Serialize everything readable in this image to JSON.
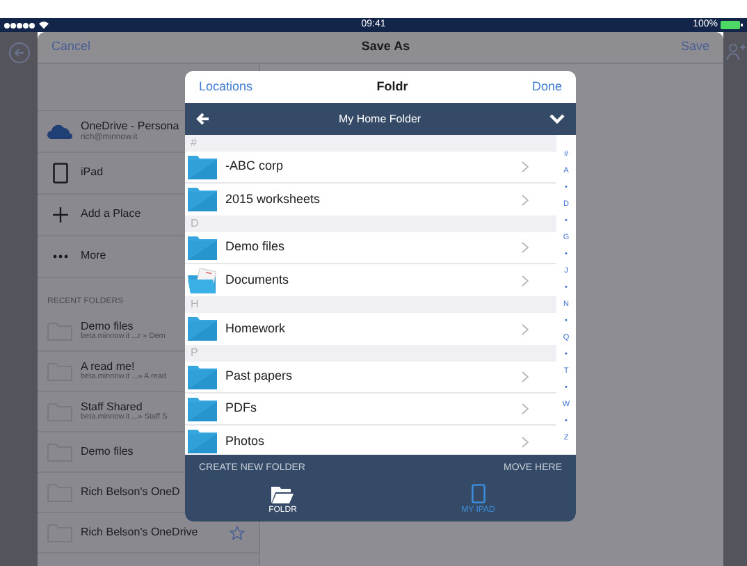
{
  "status_bar": {
    "time": "09:41",
    "battery": "100%"
  },
  "sheet": {
    "cancel": "Cancel",
    "title": "Save As",
    "save": "Save"
  },
  "sidebar": {
    "places": [
      {
        "kind": "onedrive",
        "label": "OneDrive - Persona",
        "sublabel": "rich@minnow.it"
      },
      {
        "kind": "ipad",
        "label": "iPad"
      },
      {
        "kind": "add",
        "label": "Add a Place"
      },
      {
        "kind": "more",
        "label": "More"
      }
    ],
    "recent_header": "RECENT FOLDERS",
    "recent": [
      {
        "name": "Demo files",
        "path": "beta.minnow.it ...r » Dem",
        "pinned": false
      },
      {
        "name": "A read me!",
        "path": "beta.minnow.it ...» A read",
        "pinned": false
      },
      {
        "name": "Staff Shared",
        "path": "beta.minnow.it ...» Staff S",
        "pinned": false
      },
      {
        "name": "Demo files",
        "pinned": false
      },
      {
        "name": "Rich Belson's OneD",
        "pinned": false
      },
      {
        "name": "Rich Belson's OneDrive",
        "pinned": true
      }
    ]
  },
  "popover": {
    "left": "Locations",
    "title": "Foldr",
    "right": "Done",
    "folder_title": "My Home Folder",
    "sections": [
      {
        "header": "#",
        "items": [
          {
            "name": "-ABC corp",
            "kind": "folder"
          },
          {
            "name": "2015 worksheets",
            "kind": "folder"
          }
        ]
      },
      {
        "header": "D",
        "items": [
          {
            "name": "Demo files",
            "kind": "folder"
          },
          {
            "name": "Documents",
            "kind": "documents"
          }
        ]
      },
      {
        "header": "H",
        "items": [
          {
            "name": "Homework",
            "kind": "folder"
          }
        ]
      },
      {
        "header": "P",
        "items": [
          {
            "name": "Past papers",
            "kind": "folder"
          },
          {
            "name": "PDFs",
            "kind": "folder"
          },
          {
            "name": "Photos",
            "kind": "folder"
          }
        ]
      }
    ],
    "index": [
      "#",
      "A",
      "•",
      "D",
      "•",
      "G",
      "•",
      "J",
      "•",
      "N",
      "•",
      "Q",
      "•",
      "T",
      "•",
      "W",
      "•",
      "Z"
    ],
    "create": "CREATE NEW FOLDER",
    "move": "MOVE HERE",
    "tabs": [
      {
        "label": "FOLDR",
        "kind": "foldr",
        "selected": false
      },
      {
        "label": "MY IPAD",
        "kind": "ipad",
        "selected": true
      }
    ]
  }
}
